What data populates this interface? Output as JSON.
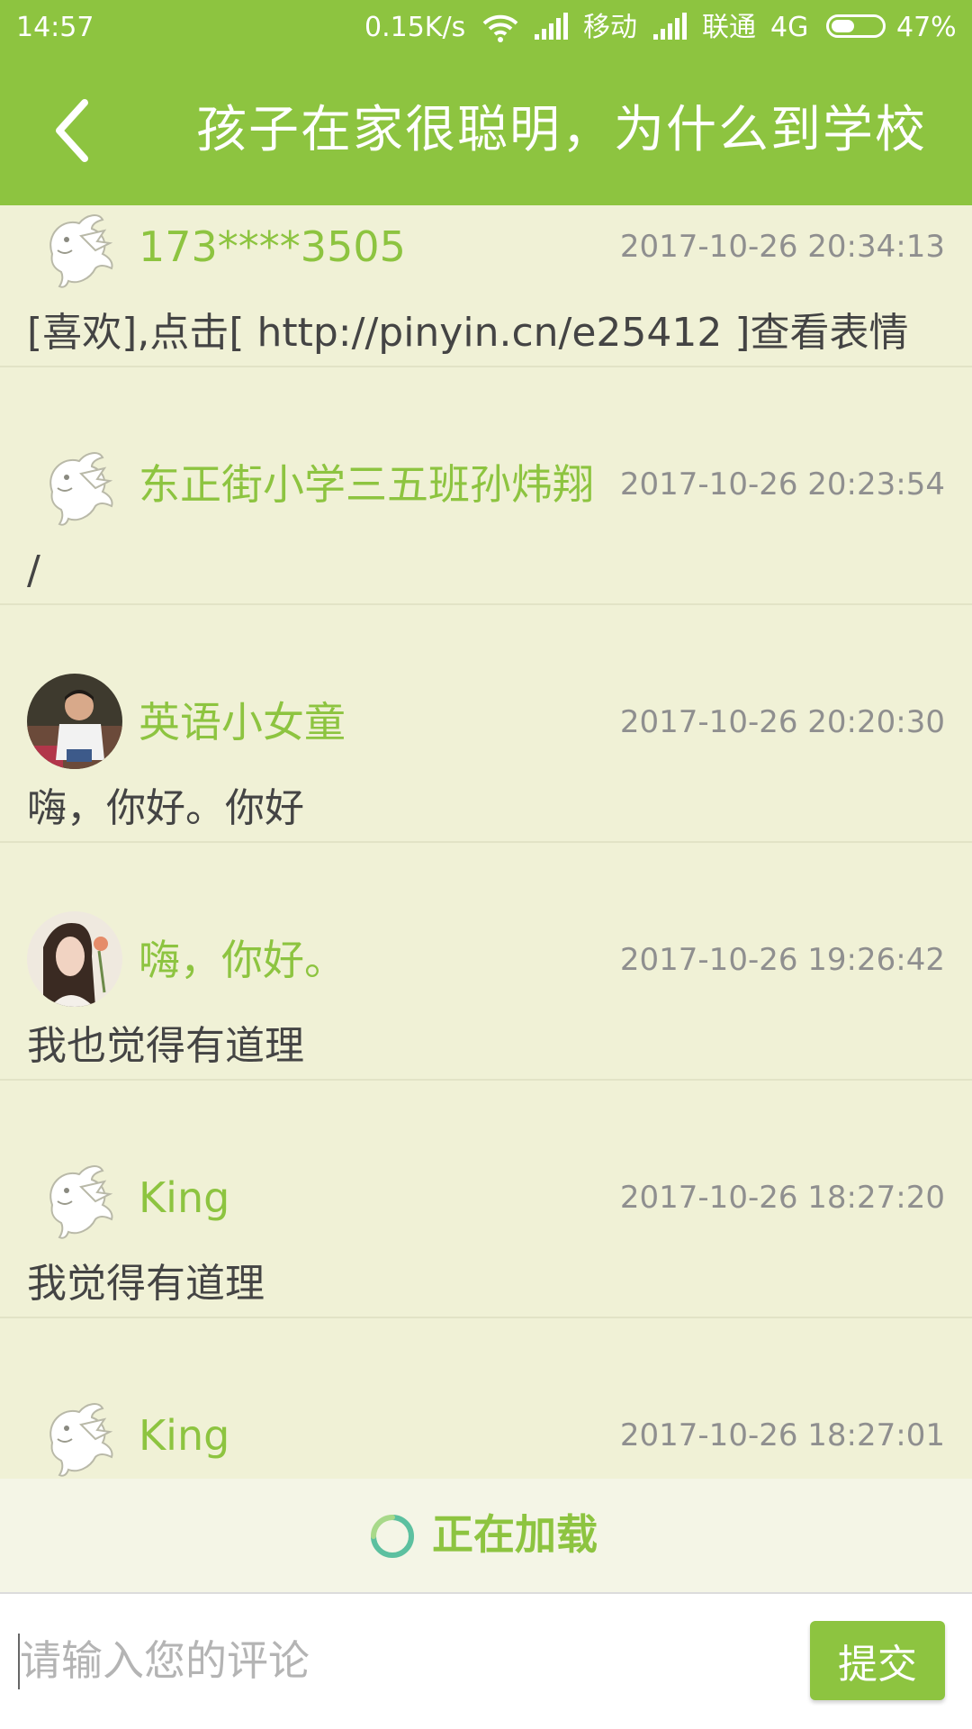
{
  "status_bar": {
    "time": "14:57",
    "speed": "0.15K/s",
    "carrier1": "移动",
    "carrier2": "联通",
    "network": "4G",
    "battery_percent": "47%",
    "battery_level": 0.47
  },
  "header": {
    "title": "孩子在家很聪明，为什么到学校",
    "back_icon": "chevron-left-icon"
  },
  "colors": {
    "accent": "#8dc440",
    "background": "#f0f1d6",
    "time_text": "#8f8f8f",
    "body_text": "#444444"
  },
  "comments": [
    {
      "user": "173****3505",
      "time": "2017-10-26 20:34:13",
      "text": "[喜欢],点击[ http://pinyin.cn/e25412 ]查看表情",
      "avatar": "dragon-mascot-icon"
    },
    {
      "user": "东正街小学三五班孙炜翔",
      "time": "2017-10-26 20:23:54",
      "text": "/",
      "avatar": "dragon-mascot-icon"
    },
    {
      "user": "英语小女童",
      "time": "2017-10-26 20:20:30",
      "text": "嗨，你好。你好",
      "avatar": "child-photo-avatar"
    },
    {
      "user": "嗨，你好。",
      "time": "2017-10-26 19:26:42",
      "text": "我也觉得有道理",
      "avatar": "woman-photo-avatar"
    },
    {
      "user": "King",
      "time": "2017-10-26 18:27:20",
      "text": "我觉得有道理",
      "avatar": "dragon-mascot-icon"
    },
    {
      "user": "King",
      "time": "2017-10-26 18:27:01",
      "text": "",
      "avatar": "dragon-mascot-icon"
    }
  ],
  "loading": {
    "text": "正在加载",
    "icon": "loading-spinner-icon"
  },
  "input_bar": {
    "placeholder": "请输入您的评论",
    "value": "",
    "submit_label": "提交"
  }
}
